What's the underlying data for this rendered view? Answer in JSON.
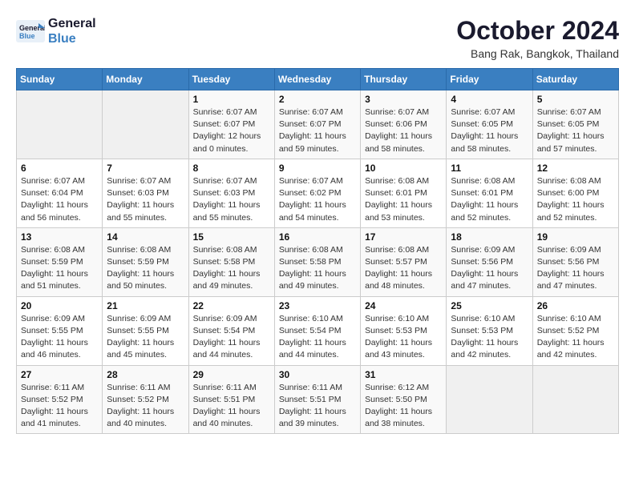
{
  "header": {
    "logo_line1": "General",
    "logo_line2": "Blue",
    "title": "October 2024",
    "subtitle": "Bang Rak, Bangkok, Thailand"
  },
  "weekdays": [
    "Sunday",
    "Monday",
    "Tuesday",
    "Wednesday",
    "Thursday",
    "Friday",
    "Saturday"
  ],
  "weeks": [
    [
      {
        "day": "",
        "info": ""
      },
      {
        "day": "",
        "info": ""
      },
      {
        "day": "1",
        "info": "Sunrise: 6:07 AM\nSunset: 6:07 PM\nDaylight: 12 hours\nand 0 minutes."
      },
      {
        "day": "2",
        "info": "Sunrise: 6:07 AM\nSunset: 6:07 PM\nDaylight: 11 hours\nand 59 minutes."
      },
      {
        "day": "3",
        "info": "Sunrise: 6:07 AM\nSunset: 6:06 PM\nDaylight: 11 hours\nand 58 minutes."
      },
      {
        "day": "4",
        "info": "Sunrise: 6:07 AM\nSunset: 6:05 PM\nDaylight: 11 hours\nand 58 minutes."
      },
      {
        "day": "5",
        "info": "Sunrise: 6:07 AM\nSunset: 6:05 PM\nDaylight: 11 hours\nand 57 minutes."
      }
    ],
    [
      {
        "day": "6",
        "info": "Sunrise: 6:07 AM\nSunset: 6:04 PM\nDaylight: 11 hours\nand 56 minutes."
      },
      {
        "day": "7",
        "info": "Sunrise: 6:07 AM\nSunset: 6:03 PM\nDaylight: 11 hours\nand 55 minutes."
      },
      {
        "day": "8",
        "info": "Sunrise: 6:07 AM\nSunset: 6:03 PM\nDaylight: 11 hours\nand 55 minutes."
      },
      {
        "day": "9",
        "info": "Sunrise: 6:07 AM\nSunset: 6:02 PM\nDaylight: 11 hours\nand 54 minutes."
      },
      {
        "day": "10",
        "info": "Sunrise: 6:08 AM\nSunset: 6:01 PM\nDaylight: 11 hours\nand 53 minutes."
      },
      {
        "day": "11",
        "info": "Sunrise: 6:08 AM\nSunset: 6:01 PM\nDaylight: 11 hours\nand 52 minutes."
      },
      {
        "day": "12",
        "info": "Sunrise: 6:08 AM\nSunset: 6:00 PM\nDaylight: 11 hours\nand 52 minutes."
      }
    ],
    [
      {
        "day": "13",
        "info": "Sunrise: 6:08 AM\nSunset: 5:59 PM\nDaylight: 11 hours\nand 51 minutes."
      },
      {
        "day": "14",
        "info": "Sunrise: 6:08 AM\nSunset: 5:59 PM\nDaylight: 11 hours\nand 50 minutes."
      },
      {
        "day": "15",
        "info": "Sunrise: 6:08 AM\nSunset: 5:58 PM\nDaylight: 11 hours\nand 49 minutes."
      },
      {
        "day": "16",
        "info": "Sunrise: 6:08 AM\nSunset: 5:58 PM\nDaylight: 11 hours\nand 49 minutes."
      },
      {
        "day": "17",
        "info": "Sunrise: 6:08 AM\nSunset: 5:57 PM\nDaylight: 11 hours\nand 48 minutes."
      },
      {
        "day": "18",
        "info": "Sunrise: 6:09 AM\nSunset: 5:56 PM\nDaylight: 11 hours\nand 47 minutes."
      },
      {
        "day": "19",
        "info": "Sunrise: 6:09 AM\nSunset: 5:56 PM\nDaylight: 11 hours\nand 47 minutes."
      }
    ],
    [
      {
        "day": "20",
        "info": "Sunrise: 6:09 AM\nSunset: 5:55 PM\nDaylight: 11 hours\nand 46 minutes."
      },
      {
        "day": "21",
        "info": "Sunrise: 6:09 AM\nSunset: 5:55 PM\nDaylight: 11 hours\nand 45 minutes."
      },
      {
        "day": "22",
        "info": "Sunrise: 6:09 AM\nSunset: 5:54 PM\nDaylight: 11 hours\nand 44 minutes."
      },
      {
        "day": "23",
        "info": "Sunrise: 6:10 AM\nSunset: 5:54 PM\nDaylight: 11 hours\nand 44 minutes."
      },
      {
        "day": "24",
        "info": "Sunrise: 6:10 AM\nSunset: 5:53 PM\nDaylight: 11 hours\nand 43 minutes."
      },
      {
        "day": "25",
        "info": "Sunrise: 6:10 AM\nSunset: 5:53 PM\nDaylight: 11 hours\nand 42 minutes."
      },
      {
        "day": "26",
        "info": "Sunrise: 6:10 AM\nSunset: 5:52 PM\nDaylight: 11 hours\nand 42 minutes."
      }
    ],
    [
      {
        "day": "27",
        "info": "Sunrise: 6:11 AM\nSunset: 5:52 PM\nDaylight: 11 hours\nand 41 minutes."
      },
      {
        "day": "28",
        "info": "Sunrise: 6:11 AM\nSunset: 5:52 PM\nDaylight: 11 hours\nand 40 minutes."
      },
      {
        "day": "29",
        "info": "Sunrise: 6:11 AM\nSunset: 5:51 PM\nDaylight: 11 hours\nand 40 minutes."
      },
      {
        "day": "30",
        "info": "Sunrise: 6:11 AM\nSunset: 5:51 PM\nDaylight: 11 hours\nand 39 minutes."
      },
      {
        "day": "31",
        "info": "Sunrise: 6:12 AM\nSunset: 5:50 PM\nDaylight: 11 hours\nand 38 minutes."
      },
      {
        "day": "",
        "info": ""
      },
      {
        "day": "",
        "info": ""
      }
    ]
  ]
}
